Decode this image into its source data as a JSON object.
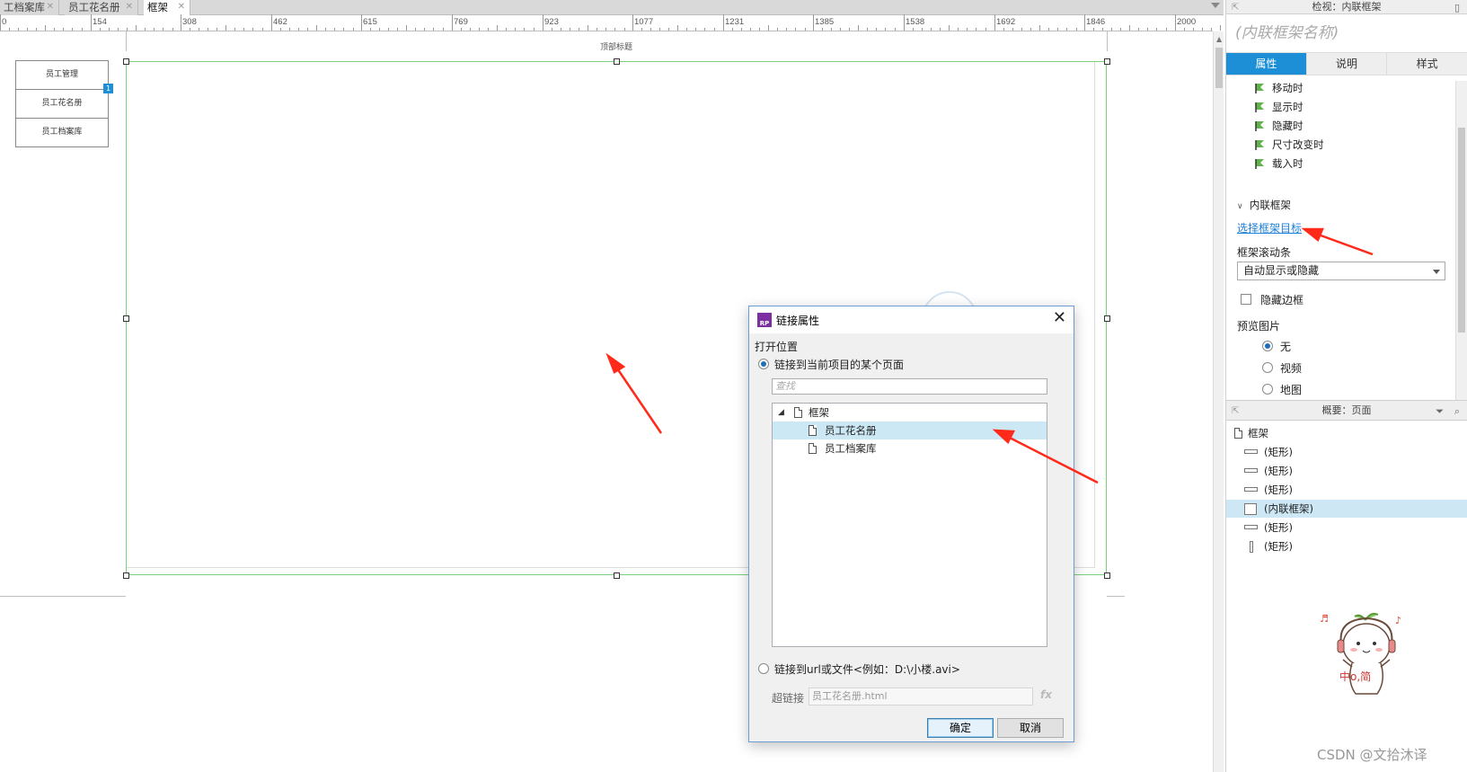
{
  "tabs": [
    {
      "label": "工档案库"
    },
    {
      "label": "员工花名册"
    },
    {
      "label": "框架"
    }
  ],
  "ruler_marks": [
    "0",
    "154",
    "308",
    "462",
    "615",
    "769",
    "923",
    "1077",
    "1231",
    "1385",
    "1538",
    "1692",
    "1846",
    "2000"
  ],
  "canvas": {
    "top_title": "顶部标题",
    "nav": [
      "员工管理",
      "员工花名册",
      "员工档案库"
    ],
    "badge": "1"
  },
  "inspector": {
    "header": "检视：内联框架",
    "widget_name": "(内联框架名称)",
    "tabs": [
      "属性",
      "说明",
      "样式"
    ],
    "active_tab": "属性",
    "events": [
      "移动时",
      "显示时",
      "隐藏时",
      "尺寸改变时",
      "载入时"
    ],
    "section": "内联框架",
    "select_target_link": "选择框架目标",
    "scrollbar_label": "框架滚动条",
    "scrollbar_value": "自动显示或隐藏",
    "hide_border": "隐藏边框",
    "preview_label": "预览图片",
    "preview_options": [
      "无",
      "视频",
      "地图"
    ],
    "preview_selected": "无"
  },
  "outline": {
    "header": "概要：页面",
    "root": "框架",
    "items": [
      "(矩形)",
      "(矩形)",
      "(矩形)",
      "(内联框架)",
      "(矩形)",
      "(矩形)"
    ],
    "selected_index": 3
  },
  "dialog": {
    "title": "链接属性",
    "open_location": "打开位置",
    "option_page": "链接到当前项目的某个页面",
    "search_placeholder": "查找",
    "tree_root": "框架",
    "tree_children": [
      "员工花名册",
      "员工档案库"
    ],
    "selected_child": "员工花名册",
    "option_url": "链接到url或文件<例如：D:\\小楼.avi>",
    "hyperlink_label": "超链接",
    "hyperlink_value": "员工花名册.html",
    "fx": "fx",
    "ok": "确定",
    "cancel": "取消"
  },
  "mascot_text": "中o,简",
  "watermark": "CSDN @文拾沐译",
  "colors": {
    "accent": "#1d8fd6",
    "annotation_arrow": "#ff2a1a",
    "frame_border": "#7ccf7c"
  }
}
